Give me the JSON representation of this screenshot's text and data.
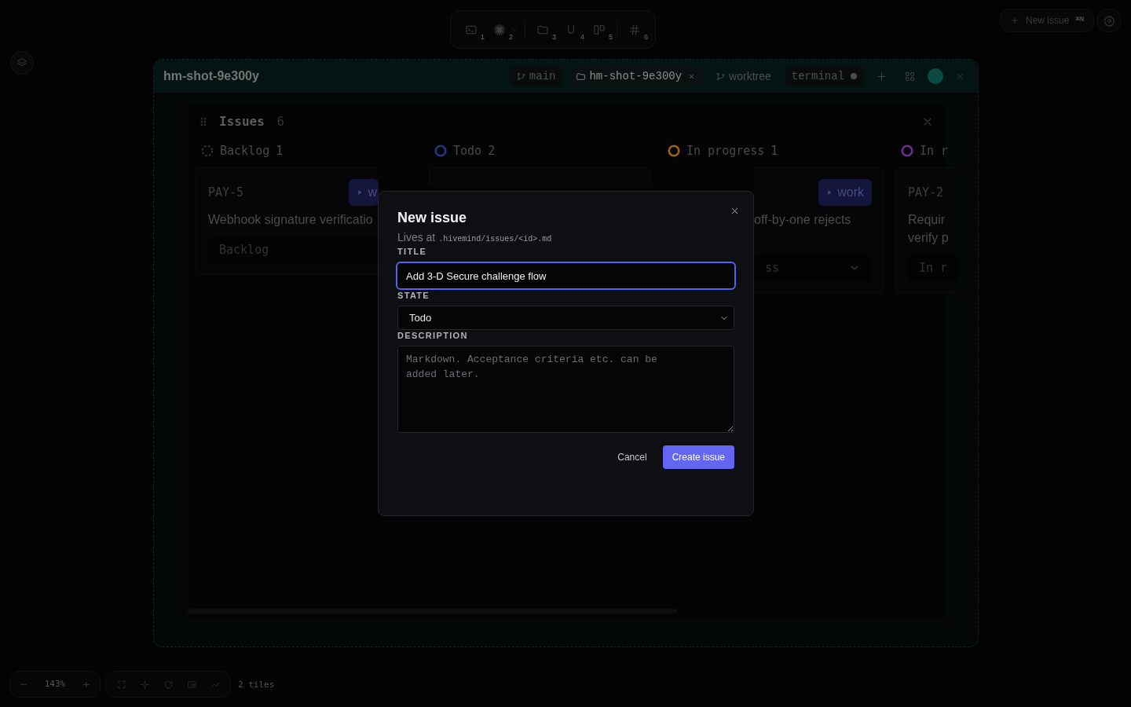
{
  "toolbar": {
    "tools": [
      {
        "kind": "terminal",
        "number": "1",
        "menu": false
      },
      {
        "kind": "sparkle",
        "number": "2",
        "menu": true
      },
      {
        "kind": "folder",
        "number": "3",
        "menu": false
      },
      {
        "kind": "magnet",
        "number": "4",
        "menu": false
      },
      {
        "kind": "board",
        "number": "5",
        "menu": false
      },
      {
        "kind": "hash",
        "number": "6",
        "menu": false
      }
    ]
  },
  "top_actions": {
    "new_issue": {
      "label": "New issue",
      "shortcut": "⌘N"
    }
  },
  "window": {
    "title": "hm-shot-9e300y",
    "tabs": [
      {
        "kind": "branch",
        "label": "main",
        "selected": false,
        "closable": false,
        "dot": false
      },
      {
        "kind": "folder",
        "label": "hm-shot-9e300y",
        "selected": true,
        "closable": true,
        "dot": false
      },
      {
        "kind": "plain-branch",
        "label": "worktree",
        "selected": false,
        "closable": false,
        "dot": false
      },
      {
        "kind": "text",
        "label": "terminal",
        "selected": false,
        "closable": false,
        "dot": true
      }
    ]
  },
  "issues_panel": {
    "title": "Issues",
    "count": "6",
    "columns": [
      {
        "name": "Backlog",
        "count": "1",
        "kind": "dashed",
        "color": "#3a3a3c",
        "cards": [
          {
            "kind": "full",
            "id": "PAY-5",
            "action": "w",
            "title_lines": [
              "Webhook signature verificatio"
            ],
            "state": "Backlog"
          }
        ]
      },
      {
        "name": "Todo",
        "count": "2",
        "kind": "ring",
        "color": "#2c3380",
        "cards": [
          {
            "kind": "covered"
          }
        ]
      },
      {
        "name": "In progress",
        "count": "1",
        "kind": "ring",
        "color": "#9a6410",
        "cards": [
          {
            "kind": "partial",
            "action": "work",
            "title_lines": [
              "off-by-one rejects"
            ],
            "state": "ss"
          }
        ]
      },
      {
        "name": "In r",
        "kind": "ring",
        "color": "#6a2f8c",
        "cards": [
          {
            "kind": "full",
            "id": "PAY-2",
            "title_lines": [
              "Requir",
              "verify p"
            ],
            "state": "In r"
          }
        ]
      }
    ]
  },
  "modal": {
    "title": "New issue",
    "subtitle": "Lives at",
    "path": ".hivemind/issues/<id>.md",
    "fields": [
      {
        "kind": "input",
        "label": "TITLE",
        "value": "Add 3-D Secure challenge flow",
        "focused": true
      },
      {
        "kind": "select",
        "label": "STATE",
        "value": "Todo",
        "focused": false
      },
      {
        "kind": "textarea",
        "label": "DESCRIPTION",
        "placeholder": "Markdown. Acceptance criteria etc. can be added later.",
        "focused": false
      }
    ],
    "buttons": [
      {
        "kind": "secondary",
        "label": "Cancel"
      },
      {
        "kind": "primary",
        "label": "Create issue"
      }
    ]
  },
  "bottom_bar": {
    "zoom": "143%",
    "minus": "−",
    "plus": "+",
    "tiles": "2 tiles"
  }
}
